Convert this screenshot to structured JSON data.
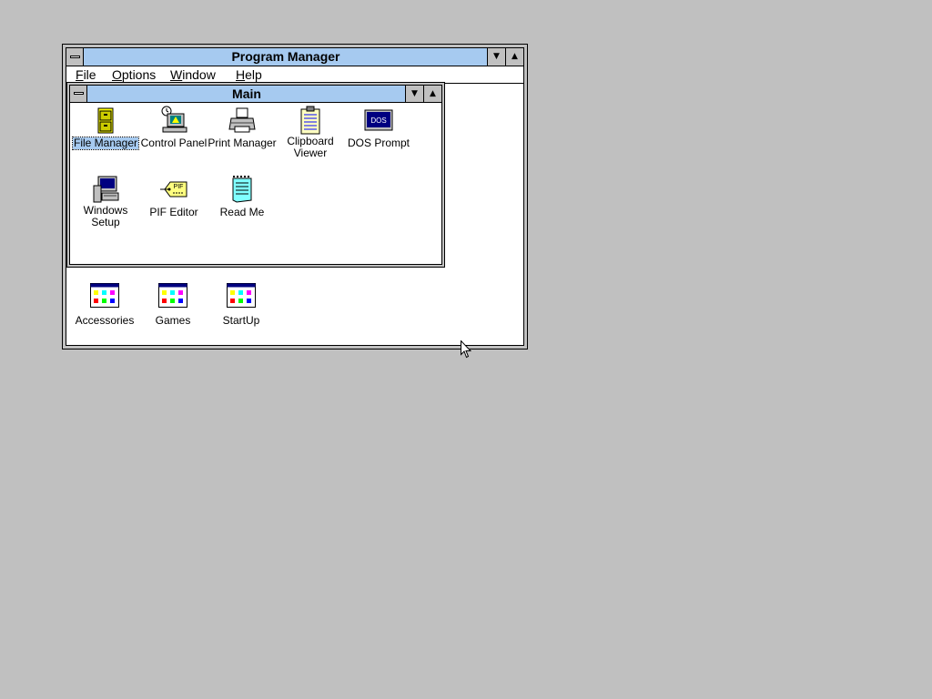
{
  "program_manager": {
    "title": "Program Manager",
    "menu": [
      {
        "label_first": "F",
        "label_rest": "ile"
      },
      {
        "label_first": "O",
        "label_rest": "ptions"
      },
      {
        "label_first": "W",
        "label_rest": "indow"
      },
      {
        "label_first": "H",
        "label_rest": "elp"
      }
    ]
  },
  "main_group": {
    "title": "Main",
    "icons": [
      {
        "label": "File Manager",
        "icon": "file-cabinet-icon",
        "selected": true
      },
      {
        "label": "Control Panel",
        "icon": "control-panel-icon"
      },
      {
        "label": "Print Manager",
        "icon": "printer-icon"
      },
      {
        "label": "Clipboard Viewer",
        "icon": "clipboard-icon"
      },
      {
        "label": "DOS Prompt",
        "icon": "dos-prompt-icon",
        "badge": "DOS"
      },
      {
        "label": "Windows Setup",
        "icon": "windows-setup-icon"
      },
      {
        "label": "PIF Editor",
        "icon": "pif-tag-icon",
        "badge": "PIF"
      },
      {
        "label": "Read Me",
        "icon": "notepad-icon"
      }
    ]
  },
  "minimized_groups": [
    {
      "label": "Accessories",
      "icon": "program-group-icon"
    },
    {
      "label": "Games",
      "icon": "program-group-icon"
    },
    {
      "label": "StartUp",
      "icon": "program-group-icon"
    }
  ],
  "colors": {
    "desktop": "#c0c0c0",
    "active_title": "#a6caf0",
    "selection": "#a6caf0"
  }
}
